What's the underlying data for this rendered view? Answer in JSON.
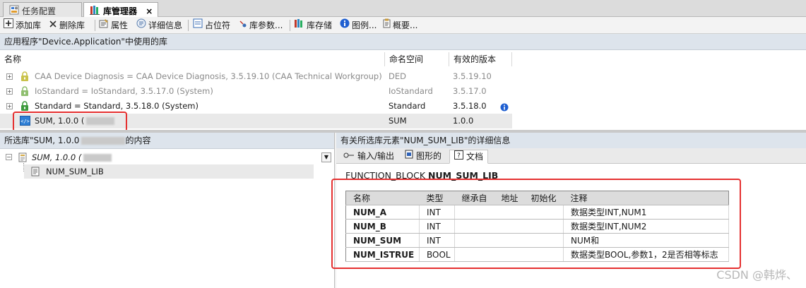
{
  "tabs": [
    {
      "label": "任务配置",
      "icon": "task-config-icon"
    },
    {
      "label": "库管理器",
      "icon": "library-manager-icon",
      "close": "×"
    }
  ],
  "toolbar": {
    "add_library": "添加库",
    "delete_library": "删除库",
    "properties": "属性",
    "details": "详细信息",
    "placeholder": "占位符",
    "library_params": "库参数...",
    "library_repository": "库存储",
    "legend": "图例...",
    "summary": "概要..."
  },
  "library_panel": {
    "title": "应用程序\"Device.Application\"中使用的库",
    "columns": [
      "名称",
      "命名空间",
      "有效的版本"
    ],
    "rows": [
      {
        "name": "CAA Device Diagnosis = CAA Device Diagnosis, 3.5.19.10 (CAA Technical Workgroup)",
        "namespace": "DED",
        "version": "3.5.19.10",
        "expander": "+",
        "greyed": true,
        "info": ""
      },
      {
        "name": "IoStandard = IoStandard, 3.5.17.0 (System)",
        "namespace": "IoStandard",
        "version": "3.5.17.0",
        "expander": "+",
        "greyed": true,
        "info": ""
      },
      {
        "name": "Standard = Standard, 3.5.18.0 (System)",
        "namespace": "Standard",
        "version": "3.5.18.0",
        "expander": "+",
        "greyed": false,
        "info": "i"
      },
      {
        "name": "SUM, 1.0.0 (",
        "namespace": "SUM",
        "version": "1.0.0",
        "expander": "",
        "greyed": false,
        "info": ""
      }
    ]
  },
  "left_panel": {
    "title_prefix": "所选库\"SUM, 1.0.0",
    "title_suffix": "的内容",
    "tree_root": "SUM, 1.0.0 (",
    "tree_child": "NUM_SUM_LIB",
    "root_expander": "−",
    "dropdown": "▼"
  },
  "right_panel": {
    "title": "有关所选库元素\"NUM_SUM_LIB\"的详细信息",
    "tabs": [
      "输入/输出",
      "图形的",
      "文档"
    ],
    "fb_keyword": "FUNCTION_BLOCK",
    "fb_name": "NUM_SUM_LIB",
    "table": {
      "headers": [
        "名称",
        "类型",
        "继承自",
        "地址",
        "初始化",
        "注释"
      ],
      "rows": [
        {
          "name": "NUM_A",
          "type": "INT",
          "inherited": "",
          "address": "",
          "init": "",
          "comment": "数据类型INT,NUM1"
        },
        {
          "name": "NUM_B",
          "type": "INT",
          "inherited": "",
          "address": "",
          "init": "",
          "comment": "数据类型INT,NUM2"
        },
        {
          "name": "NUM_SUM",
          "type": "INT",
          "inherited": "",
          "address": "",
          "init": "",
          "comment": "NUM和"
        },
        {
          "name": "NUM_ISTRUE",
          "type": "BOOL",
          "inherited": "",
          "address": "",
          "init": "",
          "comment": "数据类型BOOL,参数1，2是否相等标志"
        }
      ]
    }
  },
  "watermark": "CSDN @韩烨、",
  "colors": {
    "highlight_box": "#e53030",
    "panel_header": "#dde4ec",
    "lock_green": "#3c9a3c",
    "info_blue": "#1f5fd1"
  }
}
